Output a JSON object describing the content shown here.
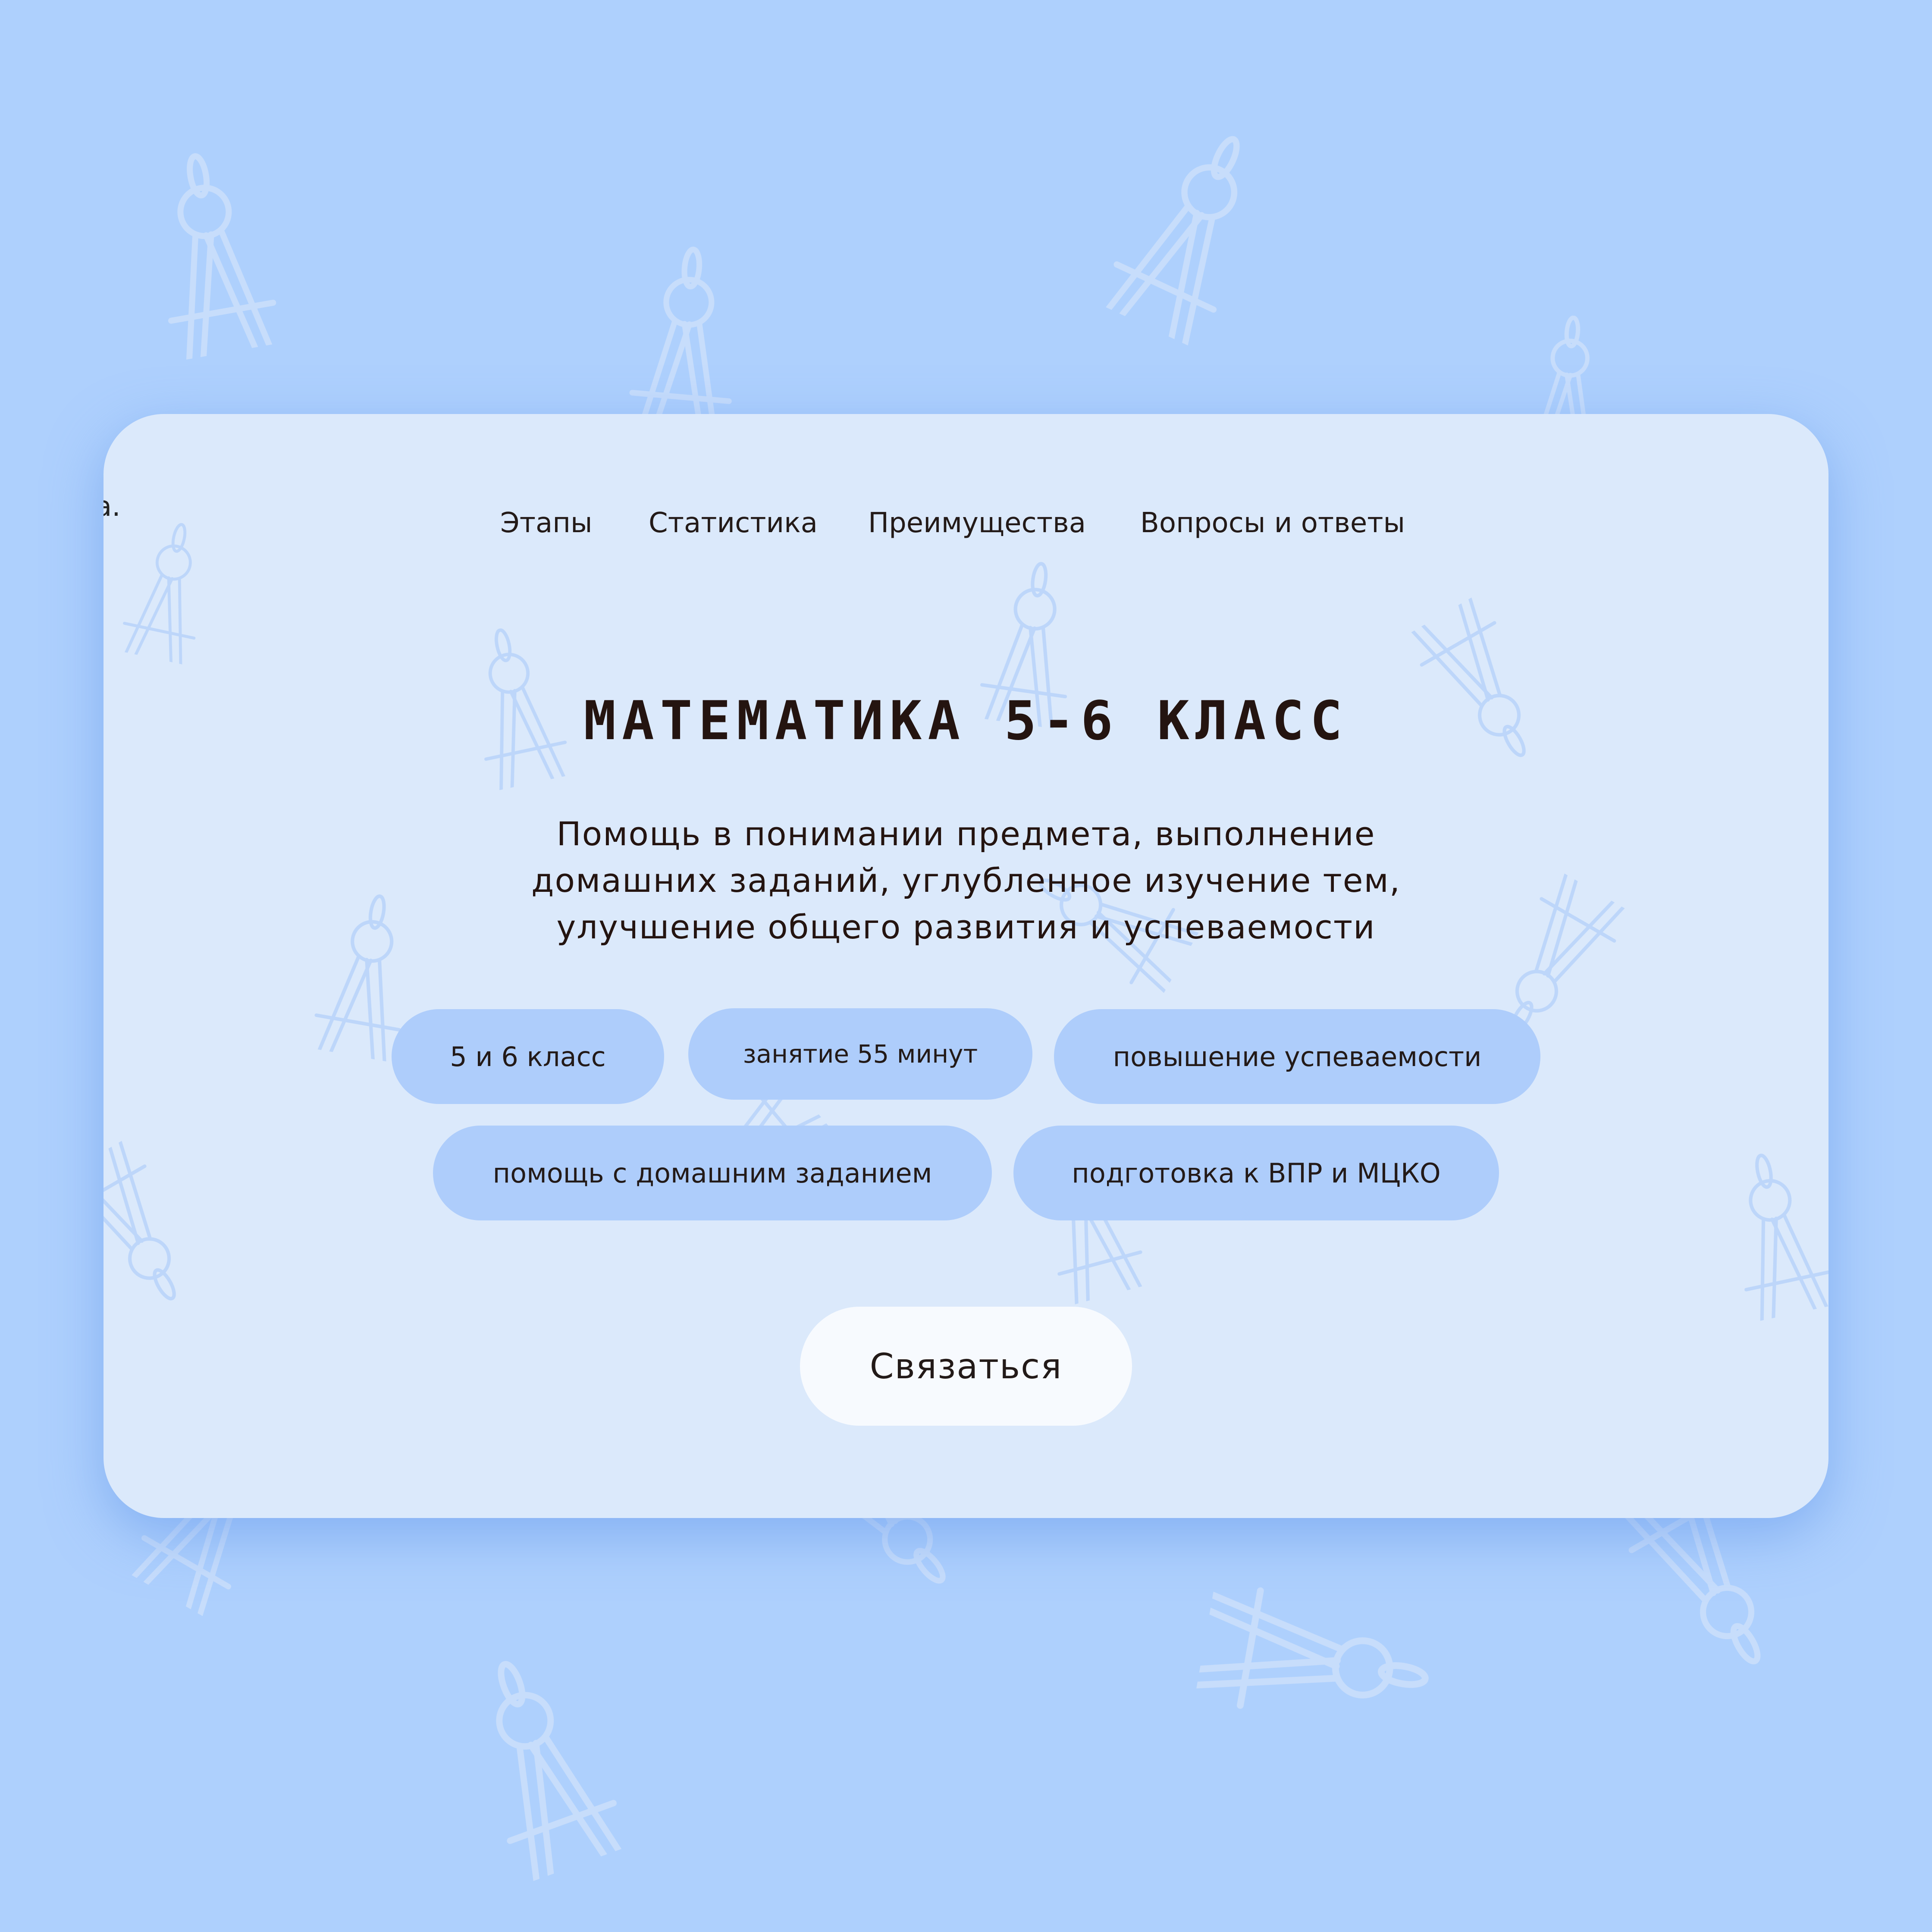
{
  "logo_fragment": "a.",
  "nav": {
    "items": [
      {
        "label": "Этапы"
      },
      {
        "label": "Статистика"
      },
      {
        "label": "Преимущества"
      },
      {
        "label": "Вопросы и ответы"
      }
    ]
  },
  "hero": {
    "title": "МАТЕМАТИКА 5-6 КЛАСС",
    "subtitle_lines": [
      "Помощь в понимании предмета, выполнение",
      "домашних заданий, углубленное изучение тем,",
      "улучшение общего развития и успеваемости"
    ]
  },
  "tags": [
    "5 и 6 класс",
    "занятие 55 минут",
    "повышение успеваемости",
    "помощь с домашним заданием",
    "подготовка к ВПР и МЦКО"
  ],
  "cta": {
    "label": "Связаться"
  },
  "colors": {
    "page_background": "#aed0fd",
    "card_background": "#dbe9fb",
    "chip_background": "#aecdfb",
    "cta_background": "#f7fafe",
    "text": "#231a18",
    "pattern_stroke": "#c9defb"
  },
  "decor": {
    "pattern_icon": "drafting-compass-icon"
  }
}
